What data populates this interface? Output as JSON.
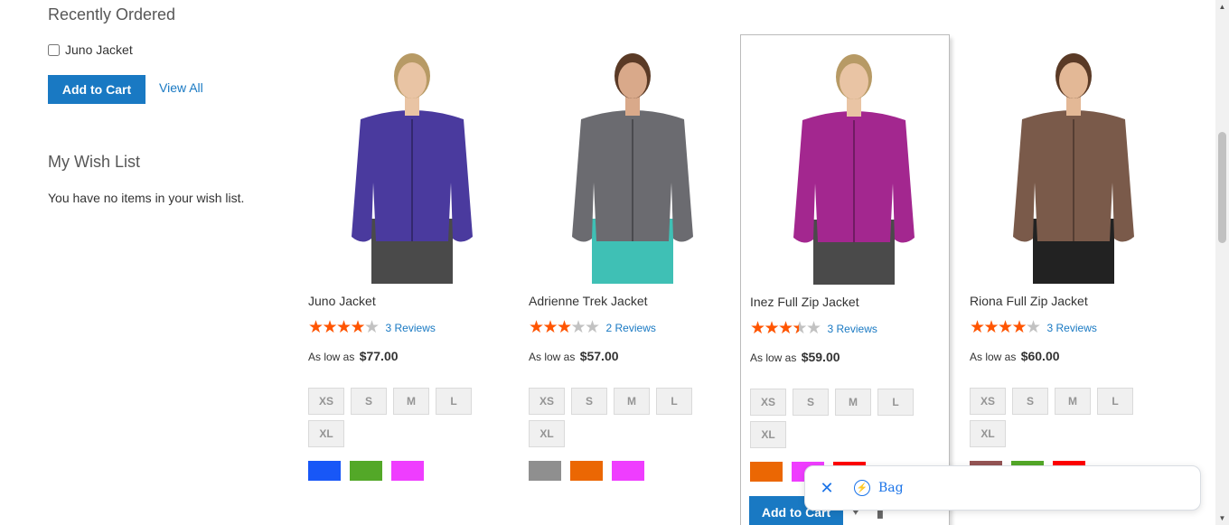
{
  "sidebar": {
    "recently_ordered": {
      "title": "Recently Ordered",
      "item_label": "Juno Jacket",
      "add_to_cart": "Add to Cart",
      "view_all": "View All"
    },
    "wishlist": {
      "title": "My Wish List",
      "empty_message": "You have no items in your wish list."
    }
  },
  "products": [
    {
      "name": "Juno Jacket",
      "rating": 4,
      "reviews": "3 Reviews",
      "price_label": "As low as",
      "price": "$77.00",
      "sizes": [
        "XS",
        "S",
        "M",
        "L",
        "XL"
      ],
      "colors": [
        "#1857f7",
        "#53a828",
        "#ef3dff"
      ],
      "jacket_color": "#4a3a9e",
      "skin": "#e9c4a4",
      "hair": "#b79a65",
      "pants": "#4a4a4a"
    },
    {
      "name": "Adrienne Trek Jacket",
      "rating": 3,
      "reviews": "2 Reviews",
      "price_label": "As low as",
      "price": "$57.00",
      "sizes": [
        "XS",
        "S",
        "M",
        "L",
        "XL"
      ],
      "colors": [
        "#8f8f8f",
        "#eb6703",
        "#ef3dff"
      ],
      "jacket_color": "#6b6b70",
      "skin": "#d9a98a",
      "hair": "#5a3a26",
      "pants": "#3fc0b5"
    },
    {
      "name": "Inez Full Zip Jacket",
      "rating": 3.5,
      "reviews": "3 Reviews",
      "price_label": "As low as",
      "price": "$59.00",
      "sizes": [
        "XS",
        "S",
        "M",
        "L",
        "XL"
      ],
      "colors": [
        "#eb6703",
        "#ef3dff",
        "#ff0000"
      ],
      "jacket_color": "#a3278f",
      "skin": "#e9c4a4",
      "hair": "#b79a65",
      "pants": "#4a4a4a",
      "add_to_cart": "Add to Cart"
    },
    {
      "name": "Riona Full Zip Jacket",
      "rating": 4,
      "reviews": "3 Reviews",
      "price_label": "As low as",
      "price": "$60.00",
      "sizes": [
        "XS",
        "S",
        "M",
        "L",
        "XL"
      ],
      "colors": [
        "#945454",
        "#53a828",
        "#ff0000"
      ],
      "jacket_color": "#7a5a4a",
      "skin": "#e3b896",
      "hair": "#5a3a26",
      "pants": "#222222"
    }
  ],
  "icons": {
    "wishlist": "heart-icon",
    "compare": "bar-chart-icon",
    "close": "close-icon",
    "bag": "lightning-bolt-icon"
  },
  "bag_bar": {
    "label": "Bag"
  },
  "colors": {
    "accent": "#1979c3",
    "star": "#ff5501",
    "bag_link": "#1a73e8"
  }
}
